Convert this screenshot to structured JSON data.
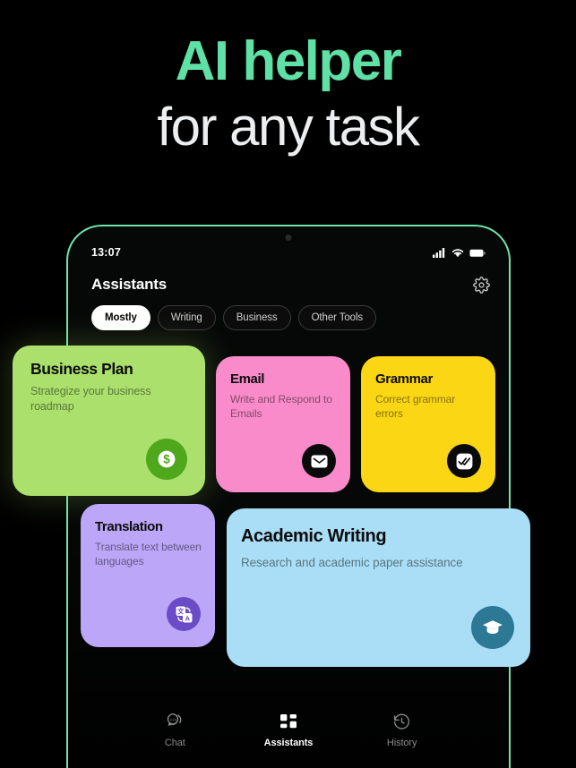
{
  "hero": {
    "line1": "AI helper",
    "line2": "for any task",
    "accent_color": "#5FE0A6",
    "line2_color": "#ECEEF0"
  },
  "phone": {
    "frame_color": "#6FE3B0",
    "statusbar": {
      "time": "13:07",
      "icons": [
        "signal-icon",
        "wifi-icon",
        "battery-icon"
      ]
    },
    "topbar": {
      "title": "Assistants",
      "settings_icon": "gear-icon"
    },
    "tabs": [
      {
        "label": "Mostly",
        "active": true
      },
      {
        "label": "Writing",
        "active": false
      },
      {
        "label": "Business",
        "active": false
      },
      {
        "label": "Other Tools",
        "active": false
      }
    ],
    "bottom_nav": [
      {
        "label": "Chat",
        "icon": "chat-bubble-icon",
        "active": false
      },
      {
        "label": "Assistants",
        "icon": "grid-icon",
        "active": true
      },
      {
        "label": "History",
        "icon": "clock-icon",
        "active": false
      }
    ]
  },
  "cards": [
    {
      "id": "business",
      "title": "Business Plan",
      "subtitle": "Strategize your business roadmap",
      "bg_color": "#ACE06C",
      "icon": "money-dollar-icon",
      "icon_bg": "#4FA81C"
    },
    {
      "id": "email",
      "title": "Email",
      "subtitle": "Write and Respond to Emails",
      "bg_color": "#F98BCB",
      "icon": "envelope-icon",
      "icon_bg": "#0A0A0A"
    },
    {
      "id": "grammar",
      "title": "Grammar",
      "subtitle": "Correct grammar errors",
      "bg_color": "#FBD615",
      "icon": "double-check-icon",
      "icon_bg": "#0A0A0A"
    },
    {
      "id": "translation",
      "title": "Translation",
      "subtitle": "Translate text between languages",
      "bg_color": "#BBA6F7",
      "icon": "translate-icon",
      "icon_bg": "#6B4BC6"
    },
    {
      "id": "academic",
      "title": "Academic Writing",
      "subtitle": "Research and academic paper assistance",
      "bg_color": "#A9DEF6",
      "icon": "graduation-cap-icon",
      "icon_bg": "#2D7895"
    }
  ]
}
